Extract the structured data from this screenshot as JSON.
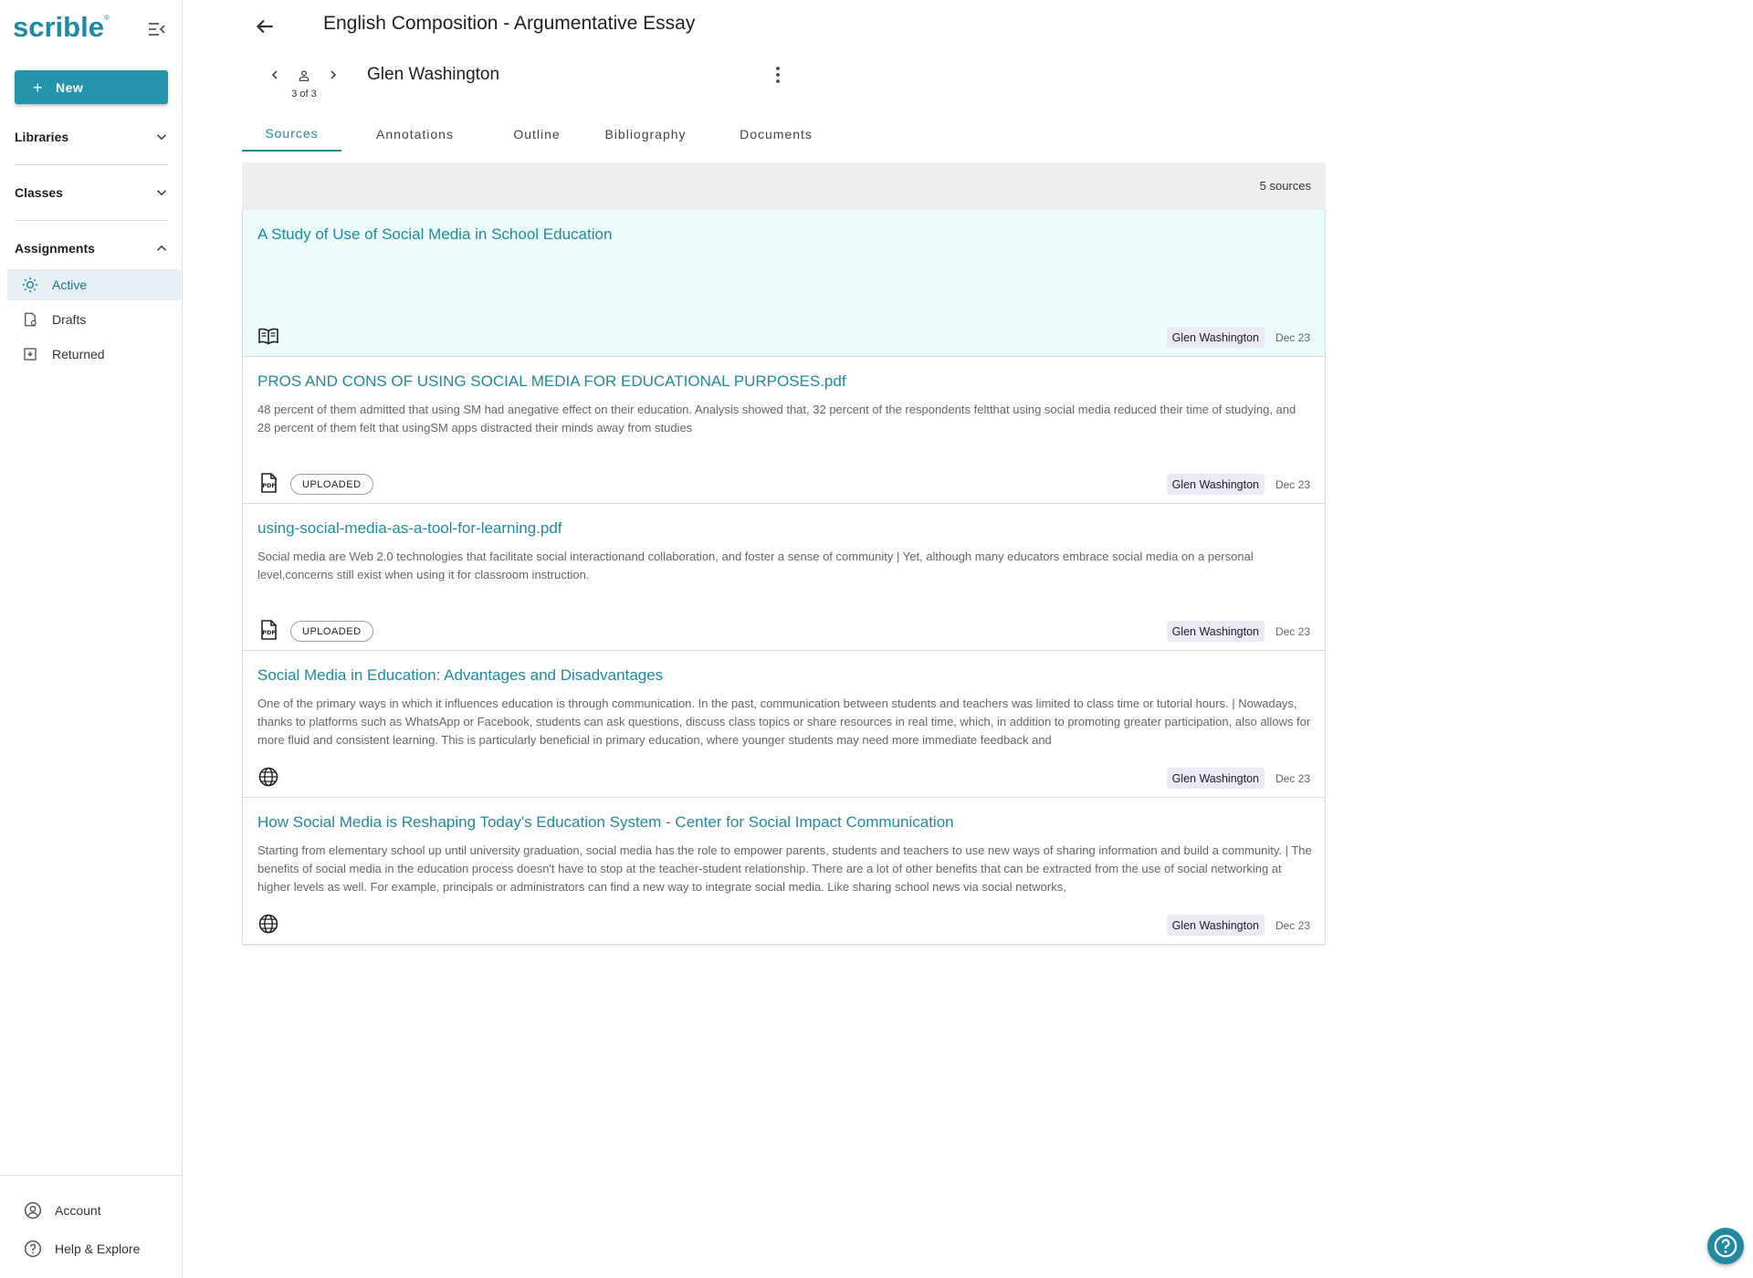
{
  "sidebar": {
    "logo": "scrible",
    "logo_mark": "®",
    "new_label": "New",
    "sections": [
      {
        "label": "Libraries",
        "icon": "chevron-down-icon"
      },
      {
        "label": "Classes",
        "icon": "chevron-down-icon"
      },
      {
        "label": "Assignments",
        "icon": "chevron-up-icon"
      }
    ],
    "items": [
      {
        "label": "Active",
        "icon": "sun-icon",
        "active": true
      },
      {
        "label": "Drafts",
        "icon": "drafts-icon",
        "active": false
      },
      {
        "label": "Returned",
        "icon": "returned-icon",
        "active": false
      }
    ],
    "bottom": [
      {
        "label": "Account",
        "icon": "account-icon"
      },
      {
        "label": "Help & Explore",
        "icon": "help-icon"
      }
    ]
  },
  "header": {
    "title": "English Composition - Argumentative Essay",
    "student_name": "Glen Washington",
    "student_count": "3 of 3"
  },
  "tabs": [
    {
      "label": "Sources",
      "active": true
    },
    {
      "label": "Annotations",
      "active": false
    },
    {
      "label": "Outline",
      "active": false
    },
    {
      "label": "Bibliography",
      "active": false
    },
    {
      "label": "Documents",
      "active": false
    }
  ],
  "sources": {
    "count_label": "5 sources",
    "items": [
      {
        "title": "A Study of Use of Social Media in School Education",
        "excerpt": "",
        "type_icon": "book-icon",
        "badge": "",
        "author": "Glen Washington",
        "date": "Dec 23",
        "selected": true
      },
      {
        "title": "PROS AND CONS OF USING SOCIAL MEDIA FOR EDUCATIONAL PURPOSES.pdf",
        "excerpt": "48 percent of them admitted that using SM had anegative effect on their education. Analysis showed that, 32 percent of the respondents feltthat using social media reduced their time of studying, and 28 percent of them felt that usingSM apps distracted their minds away from studies",
        "type_icon": "pdf-icon",
        "badge": "UPLOADED",
        "author": "Glen Washington",
        "date": "Dec 23",
        "selected": false
      },
      {
        "title": "using-social-media-as-a-tool-for-learning.pdf",
        "excerpt": "Social media are Web 2.0 technologies that facilitate social interactionand collaboration, and foster a sense of community | Yet, although many educators embrace social media on a personal level,concerns still exist when using it for classroom instruction.",
        "type_icon": "pdf-icon",
        "badge": "UPLOADED",
        "author": "Glen Washington",
        "date": "Dec 23",
        "selected": false
      },
      {
        "title": "Social Media in Education: Advantages and Disadvantages",
        "excerpt": "One of the primary ways in which it influences education is through communication. In the past, communication between students and teachers was limited to class time or tutorial hours. | Nowadays, thanks to platforms such as WhatsApp or Facebook, students can ask questions, discuss class topics or share resources in real time, which, in addition to promoting greater participation, also allows for more fluid and consistent learning. This is particularly beneficial in primary education, where younger students may need more immediate feedback and",
        "type_icon": "globe-icon",
        "badge": "",
        "author": "Glen Washington",
        "date": "Dec 23",
        "selected": false
      },
      {
        "title": "How Social Media is Reshaping Today's Education System - Center for Social Impact Communication",
        "excerpt": "Starting from elementary school up until university graduation, social media has the role to empower parents, students and teachers to use new ways of sharing information and build a community. | The benefits of social media in the education process doesn't have to stop at the teacher-student relationship. There are a lot of other benefits that can be extracted from the use of social networking at higher levels as well. For example, principals or administrators can find a new way to integrate social media. Like sharing school news via social networks,",
        "type_icon": "globe-icon",
        "badge": "",
        "author": "Glen Washington",
        "date": "Dec 23",
        "selected": false
      }
    ]
  },
  "colors": {
    "accent": "#1f8aa1",
    "new_button": "#2394aa",
    "selected_card": "#ecfbfc",
    "author_chip": "#ece9f5"
  }
}
